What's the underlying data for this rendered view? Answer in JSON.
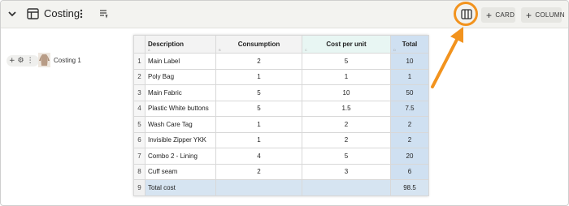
{
  "header": {
    "title": "Costing",
    "card_button": "CARD",
    "column_button": "COLUMN"
  },
  "row_item": {
    "label": "Costing 1"
  },
  "table": {
    "headers": {
      "description": "Description",
      "consumption": "Consumption",
      "cost_per_unit": "Cost per unit",
      "total": "Total"
    },
    "rows": [
      {
        "num": "1",
        "description": "Main Label",
        "consumption": "2",
        "cost": "5",
        "total": "10"
      },
      {
        "num": "2",
        "description": "Poly Bag",
        "consumption": "1",
        "cost": "1",
        "total": "1"
      },
      {
        "num": "3",
        "description": "Main Fabric",
        "consumption": "5",
        "cost": "10",
        "total": "50"
      },
      {
        "num": "4",
        "description": "Plastic White buttons",
        "consumption": "5",
        "cost": "1.5",
        "total": "7.5"
      },
      {
        "num": "5",
        "description": "Wash Care Tag",
        "consumption": "1",
        "cost": "2",
        "total": "2"
      },
      {
        "num": "6",
        "description": "Invisible Zipper YKK",
        "consumption": "1",
        "cost": "2",
        "total": "2"
      },
      {
        "num": "7",
        "description": "Combo 2 - Lining",
        "consumption": "4",
        "cost": "5",
        "total": "20"
      },
      {
        "num": "8",
        "description": "Cuff seam",
        "consumption": "2",
        "cost": "3",
        "total": "6"
      }
    ],
    "total_row": {
      "num": "9",
      "label": "Total cost",
      "value": "98.5"
    }
  },
  "colors": {
    "highlight": "#f2931e",
    "total_column": "#cfe0f1",
    "selected_column": "#e8f6f3"
  }
}
